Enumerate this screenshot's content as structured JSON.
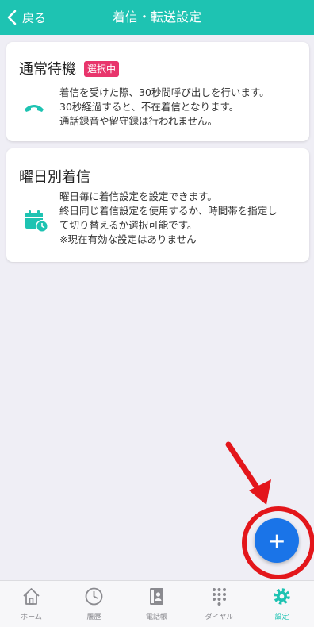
{
  "header": {
    "back_label": "戻る",
    "title": "着信・転送設定"
  },
  "cards": [
    {
      "title": "通常待機",
      "badge": "選択中",
      "icon": "phone-handset-icon",
      "lines": [
        "着信を受けた際、30秒間呼び出しを行います。",
        "30秒経過すると、不在着信となります。",
        "通話録音や留守録は行われません。"
      ]
    },
    {
      "title": "曜日別着信",
      "icon": "calendar-clock-icon",
      "lines": [
        "曜日毎に着信設定を設定できます。",
        "終日同じ着信設定を使用するか、時間帯を指定し",
        "て切り替えるか選択可能です。",
        "※現在有効な設定はありません"
      ]
    }
  ],
  "fab": {
    "label": "+"
  },
  "tabs": [
    {
      "label": "ホーム",
      "icon": "home-icon"
    },
    {
      "label": "履歴",
      "icon": "clock-icon"
    },
    {
      "label": "電話帳",
      "icon": "phonebook-icon"
    },
    {
      "label": "ダイヤル",
      "icon": "dialpad-icon"
    },
    {
      "label": "設定",
      "icon": "gear-icon",
      "active": true
    }
  ],
  "colors": {
    "accent": "#1ec3b2",
    "badge": "#e8356c",
    "fab": "#1a74e8",
    "annotation": "#e3161b"
  }
}
